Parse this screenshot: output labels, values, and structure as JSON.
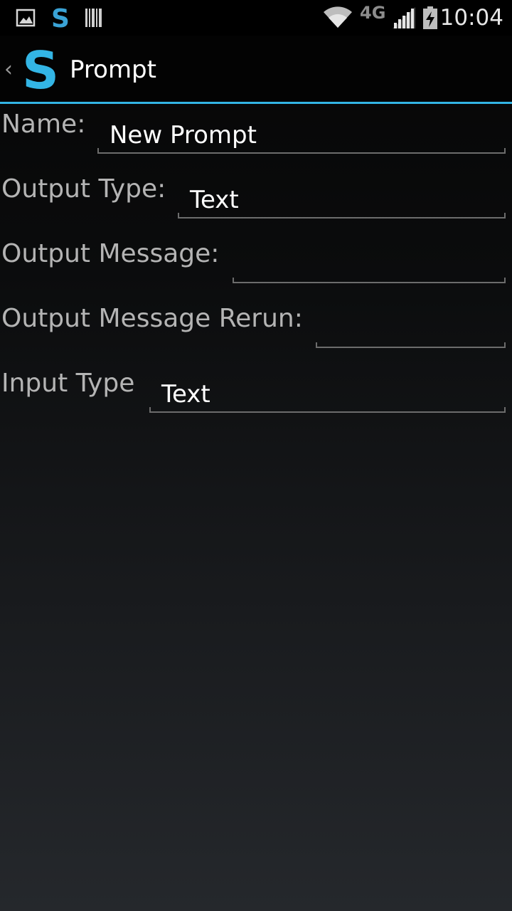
{
  "status_bar": {
    "time": "10:04",
    "network": "4G",
    "icons": [
      "gallery-notification-icon",
      "app-s-notification-icon",
      "barcode-notification-icon",
      "wifi-icon",
      "signal-icon",
      "battery-icon"
    ],
    "accent_color": "#33b5e5"
  },
  "action_bar": {
    "title": "Prompt",
    "logo_letter": "S",
    "up_glyph": "‹",
    "divider_color": "#33b5e5"
  },
  "form": {
    "name_label": "Name:",
    "name_value": "New Prompt",
    "output_type_label": "Output Type:",
    "output_type_value": "Text",
    "output_message_label": "Output Message:",
    "output_message_value": "",
    "output_message_rerun_label": "Output Message Rerun:",
    "output_message_rerun_value": "",
    "input_type_label": "Input Type",
    "input_type_value": "Text"
  }
}
